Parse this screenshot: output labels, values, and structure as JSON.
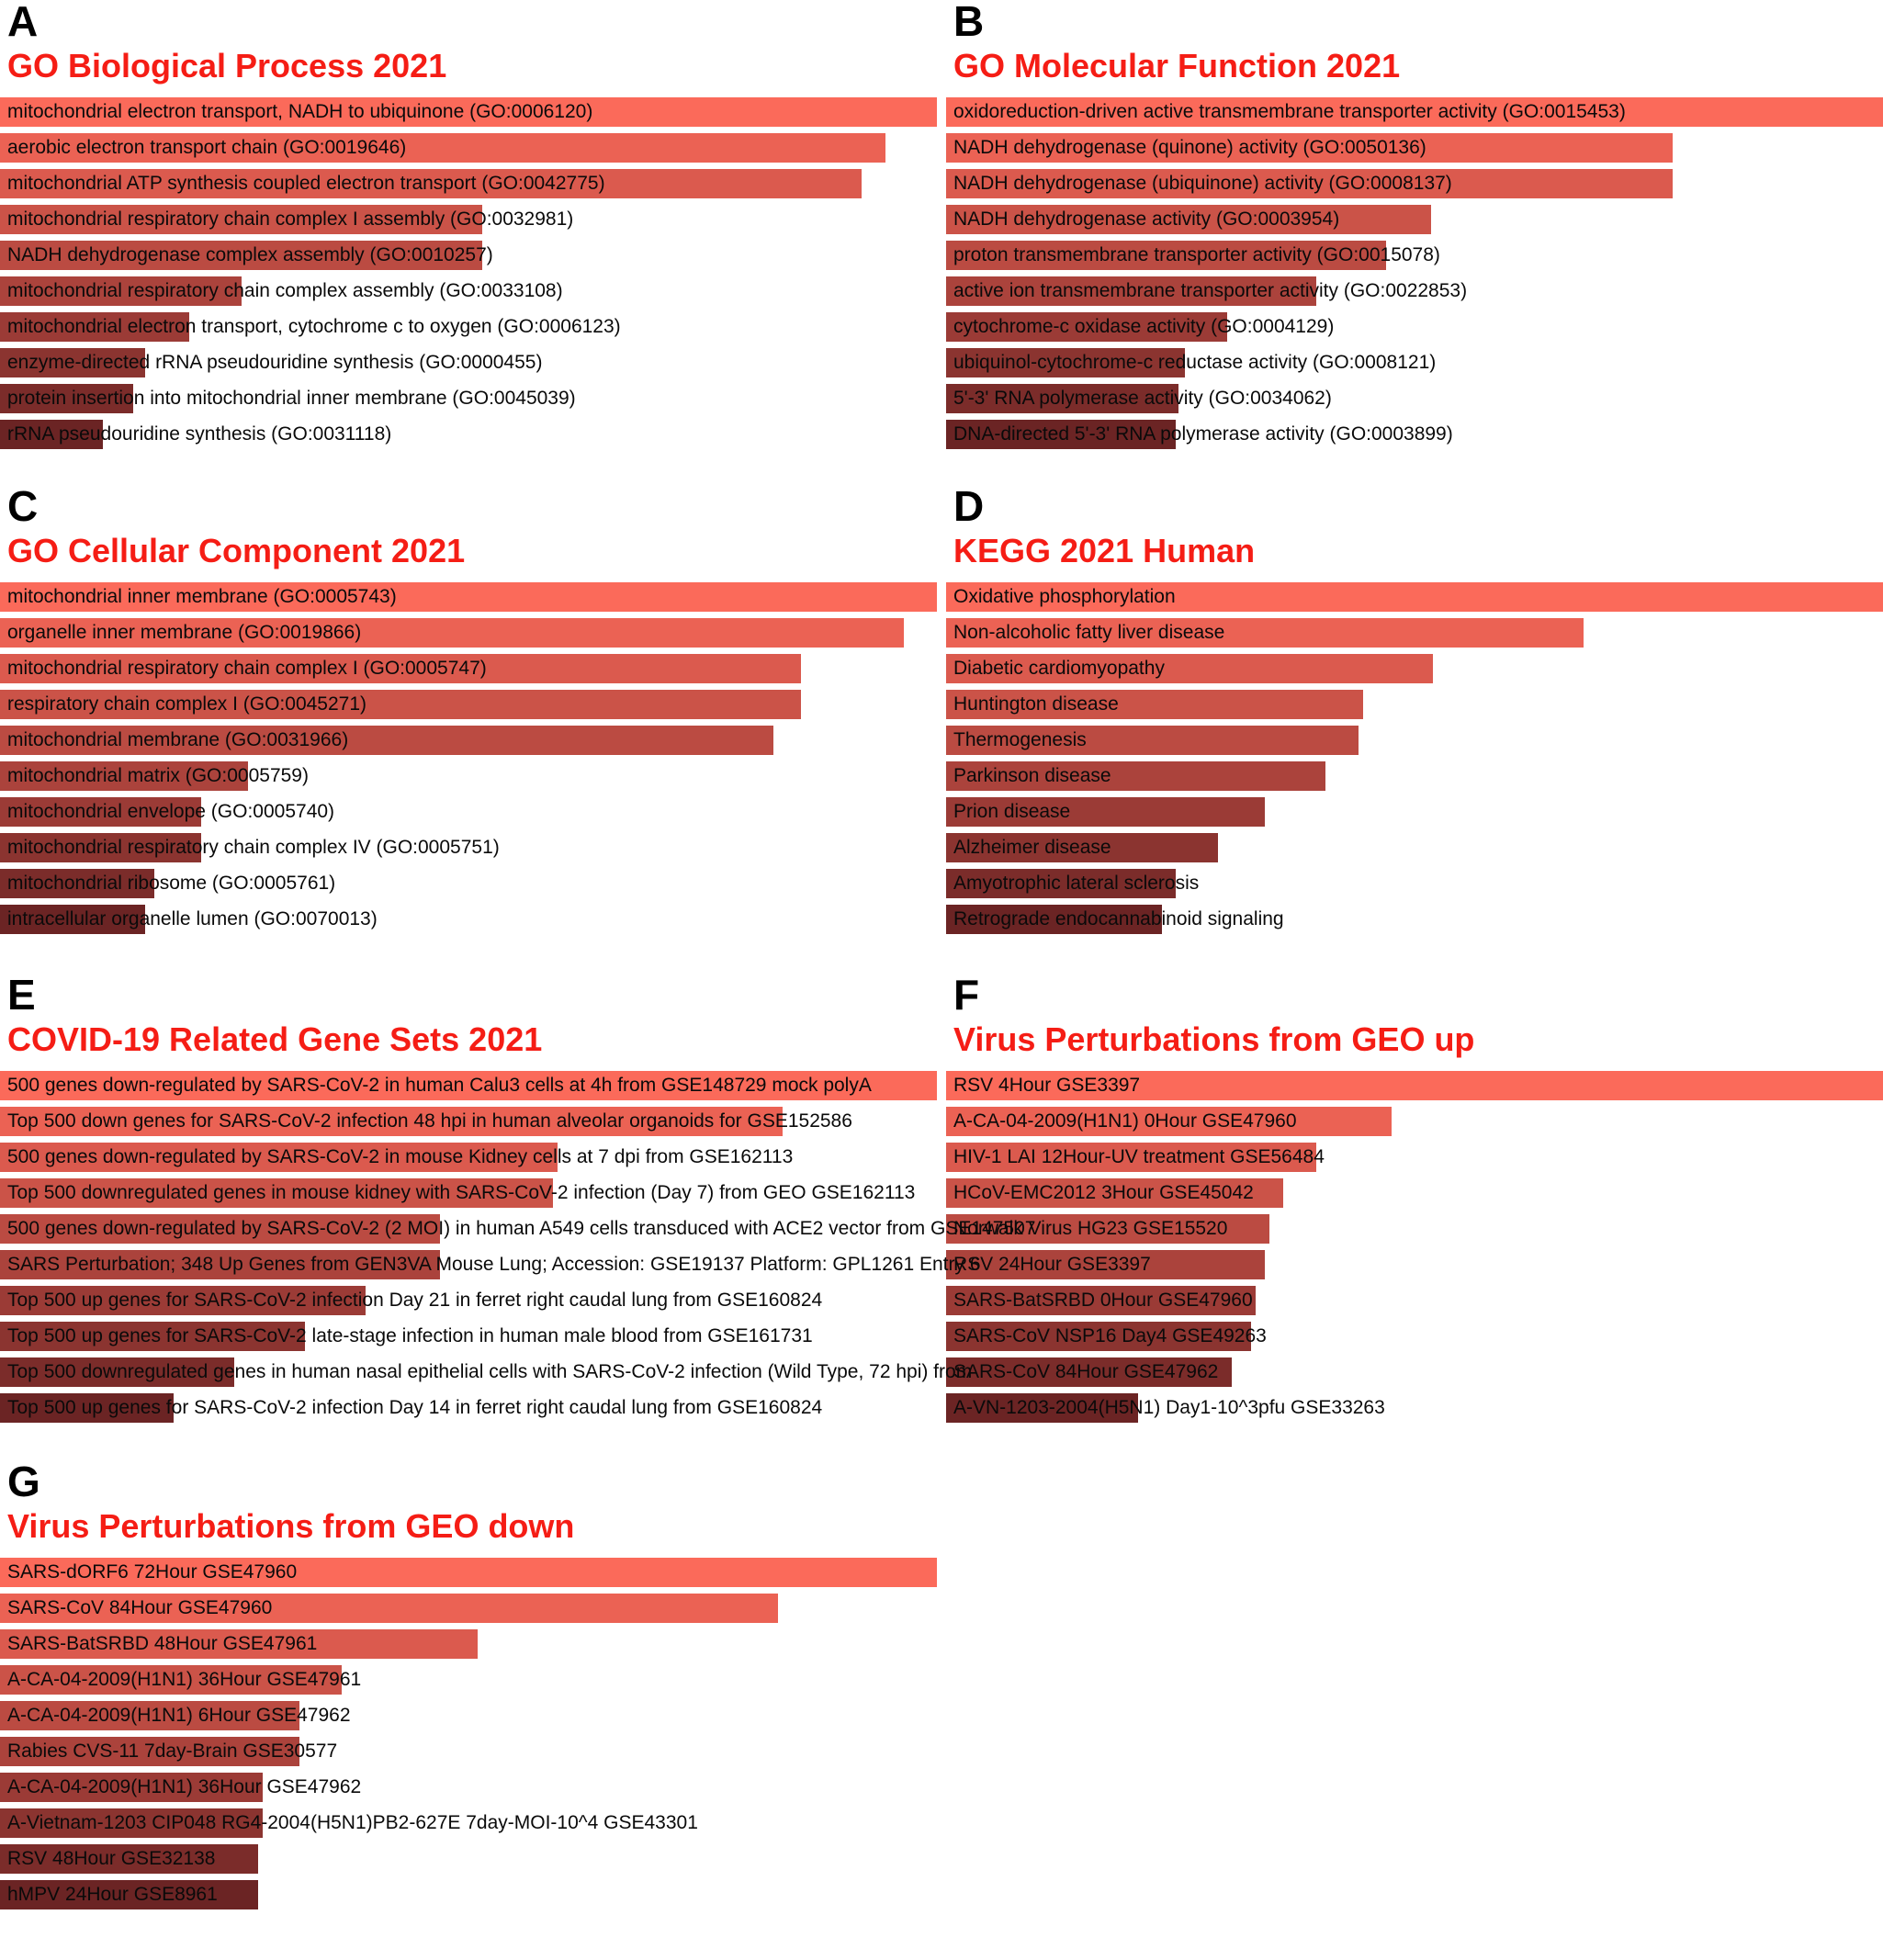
{
  "figure": {
    "accent_title_color": "#f51d15",
    "panel_letter_color": "#000000",
    "bar_color_high": "#fb6a5a",
    "bar_color_low": "#6b2424"
  },
  "chart_data": [
    {
      "type": "bar",
      "panel": "A",
      "title": "GO Biological Process 2021",
      "orientation": "horizontal",
      "xlabel": "",
      "ylabel": "",
      "grid": false,
      "legend": "none",
      "xlim": [
        0,
        100
      ],
      "categories": [
        "mitochondrial electron transport, NADH to ubiquinone (GO:0006120)",
        "aerobic electron transport chain (GO:0019646)",
        "mitochondrial ATP synthesis coupled electron transport (GO:0042775)",
        "mitochondrial respiratory chain complex I assembly (GO:0032981)",
        "NADH dehydrogenase complex assembly (GO:0010257)",
        "mitochondrial respiratory chain complex assembly (GO:0033108)",
        "mitochondrial electron transport, cytochrome c to oxygen (GO:0006123)",
        "enzyme-directed rRNA pseudouridine synthesis (GO:0000455)",
        "protein insertion into mitochondrial inner membrane (GO:0045039)",
        "rRNA pseudouridine synthesis (GO:0031118)"
      ],
      "values": [
        100,
        94.5,
        92.0,
        51.5,
        51.5,
        25.8,
        20.2,
        15.5,
        14.2,
        11.0
      ]
    },
    {
      "type": "bar",
      "panel": "B",
      "title": "GO Molecular Function 2021",
      "orientation": "horizontal",
      "xlabel": "",
      "ylabel": "",
      "grid": false,
      "legend": "none",
      "xlim": [
        0,
        100
      ],
      "categories": [
        "oxidoreduction-driven active transmembrane transporter activity (GO:0015453)",
        "NADH dehydrogenase (quinone) activity (GO:0050136)",
        "NADH dehydrogenase (ubiquinone) activity (GO:0008137)",
        "NADH dehydrogenase activity (GO:0003954)",
        "proton transmembrane transporter activity (GO:0015078)",
        "active ion transmembrane transporter activity (GO:0022853)",
        "cytochrome-c oxidase activity (GO:0004129)",
        "ubiquinol-cytochrome-c reductase activity (GO:0008121)",
        "5'-3' RNA polymerase activity (GO:0034062)",
        "DNA-directed 5'-3' RNA polymerase activity (GO:0003899)"
      ],
      "values": [
        100,
        77.5,
        77.5,
        51.8,
        47.0,
        39.5,
        30.0,
        25.5,
        24.8,
        24.5
      ]
    },
    {
      "type": "bar",
      "panel": "C",
      "title": "GO Cellular Component 2021",
      "orientation": "horizontal",
      "xlabel": "",
      "ylabel": "",
      "grid": false,
      "legend": "none",
      "xlim": [
        0,
        100
      ],
      "categories": [
        "mitochondrial inner membrane (GO:0005743)",
        "organelle inner membrane (GO:0019866)",
        "mitochondrial respiratory chain complex I (GO:0005747)",
        "respiratory chain complex I (GO:0045271)",
        "mitochondrial membrane (GO:0031966)",
        "mitochondrial matrix (GO:0005759)",
        "mitochondrial envelope (GO:0005740)",
        "mitochondrial respiratory chain complex IV (GO:0005751)",
        "mitochondrial ribosome (GO:0005761)",
        "intracellular organelle lumen (GO:0070013)"
      ],
      "values": [
        100,
        96.5,
        85.5,
        85.5,
        82.5,
        26.5,
        21.5,
        21.5,
        16.5,
        15.5
      ]
    },
    {
      "type": "bar",
      "panel": "D",
      "title": "KEGG 2021 Human",
      "orientation": "horizontal",
      "xlabel": "",
      "ylabel": "",
      "grid": false,
      "legend": "none",
      "xlim": [
        0,
        100
      ],
      "categories": [
        "Oxidative phosphorylation",
        "Non-alcoholic fatty liver disease",
        "Diabetic cardiomyopathy",
        "Huntington disease",
        "Thermogenesis",
        "Parkinson disease",
        "Prion disease",
        "Alzheimer disease",
        "Amyotrophic lateral sclerosis",
        "Retrograde endocannabinoid signaling"
      ],
      "values": [
        100,
        68.0,
        52.0,
        44.5,
        44.0,
        40.5,
        34.0,
        29.0,
        24.5,
        23.0
      ]
    },
    {
      "type": "bar",
      "panel": "E",
      "title": "COVID-19 Related Gene Sets 2021",
      "orientation": "horizontal",
      "xlabel": "",
      "ylabel": "",
      "grid": false,
      "legend": "none",
      "xlim": [
        0,
        100
      ],
      "categories": [
        "500 genes down-regulated by SARS-CoV-2 in human Calu3 cells at 4h from GSE148729 mock polyA",
        "Top 500 down genes for SARS-CoV-2 infection 48 hpi in human alveolar organoids for GSE152586",
        "500 genes down-regulated by SARS-CoV-2 in mouse Kidney cells at 7 dpi from GSE162113",
        "Top 500 downregulated genes in mouse kidney with SARS-CoV-2 infection (Day 7) from GEO GSE162113",
        "500 genes down-regulated by SARS-CoV-2 (2 MOI) in human A549 cells transduced with ACE2 vector from GSE147507",
        "SARS Perturbation; 348 Up Genes from GEN3VA Mouse Lung; Accession: GSE19137 Platform: GPL1261 Entry 6",
        "Top 500 up genes for SARS-CoV-2 infection Day 21 in ferret right caudal lung from GSE160824",
        "Top 500 up genes for SARS-CoV-2 late-stage infection in human male blood from GSE161731",
        "Top 500 downregulated genes in human nasal epithelial cells with SARS-CoV-2 infection (Wild Type, 72 hpi) from",
        "Top 500 up genes for SARS-CoV-2 infection Day 14 in ferret right caudal lung from GSE160824"
      ],
      "values": [
        100,
        83.5,
        59.5,
        59.0,
        47.0,
        47.0,
        39.0,
        32.5,
        25.0,
        18.5
      ]
    },
    {
      "type": "bar",
      "panel": "F",
      "title": "Virus Perturbations from GEO up",
      "orientation": "horizontal",
      "xlabel": "",
      "ylabel": "",
      "grid": false,
      "legend": "none",
      "xlim": [
        0,
        100
      ],
      "categories": [
        "RSV 4Hour GSE3397",
        "A-CA-04-2009(H1N1) 0Hour GSE47960",
        "HIV-1 LAI 12Hour-UV treatment GSE56484",
        "HCoV-EMC2012 3Hour GSE45042",
        "Norwalk Virus HG23 GSE15520",
        "RSV 24Hour GSE3397",
        "SARS-BatSRBD 0Hour GSE47960",
        "SARS-CoV NSP16 Day4 GSE49263",
        "SARS-CoV 84Hour GSE47962",
        "A-VN-1203-2004(H5N1) Day1-10^3pfu GSE33263"
      ],
      "values": [
        100,
        47.5,
        39.5,
        36.0,
        34.5,
        34.0,
        33.0,
        32.5,
        30.5,
        20.5
      ]
    },
    {
      "type": "bar",
      "panel": "G",
      "title": "Virus Perturbations from GEO down",
      "orientation": "horizontal",
      "xlabel": "",
      "ylabel": "",
      "grid": false,
      "legend": "none",
      "xlim": [
        0,
        100
      ],
      "categories": [
        "SARS-dORF6 72Hour GSE47960",
        "SARS-CoV 84Hour GSE47960",
        "SARS-BatSRBD 48Hour GSE47961",
        "A-CA-04-2009(H1N1) 36Hour GSE47961",
        "A-CA-04-2009(H1N1) 6Hour GSE47962",
        "Rabies CVS-11 7day-Brain GSE30577",
        "A-CA-04-2009(H1N1) 36Hour GSE47962",
        "A-Vietnam-1203 CIP048 RG4-2004(H5N1)PB2-627E 7day-MOI-10^4 GSE43301",
        "RSV 48Hour GSE32138",
        "hMPV 24Hour GSE8961"
      ],
      "values": [
        100,
        83.0,
        51.0,
        36.5,
        32.0,
        32.0,
        28.0,
        28.0,
        27.5,
        27.5
      ]
    }
  ],
  "panels": {
    "a": {
      "letter": "A",
      "title": "GO Biological Process 2021"
    },
    "b": {
      "letter": "B",
      "title": "GO Molecular Function 2021"
    },
    "c": {
      "letter": "C",
      "title": "GO Cellular Component 2021"
    },
    "d": {
      "letter": "D",
      "title": "KEGG 2021 Human"
    },
    "e": {
      "letter": "E",
      "title": "COVID-19 Related Gene Sets 2021"
    },
    "f": {
      "letter": "F",
      "title": "Virus Perturbations from GEO up"
    },
    "g": {
      "letter": "G",
      "title": "Virus Perturbations from GEO down"
    }
  }
}
